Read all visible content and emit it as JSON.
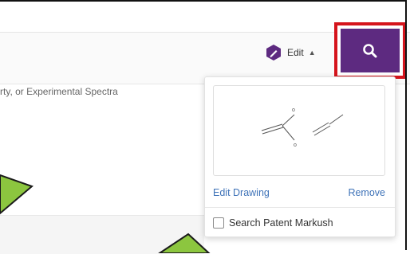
{
  "toolbar": {
    "edit_label": "Edit",
    "caret": "▲"
  },
  "search": {
    "hint_text": "rty, or Experimental Spectra"
  },
  "structure_popover": {
    "edit_drawing_label": "Edit Drawing",
    "remove_label": "Remove",
    "markush_label": "Search Patent Markush",
    "molecule_labels": [
      "o",
      "o"
    ]
  },
  "colors": {
    "search_button": "#5d2a80",
    "highlight_outline": "#d5141c",
    "link": "#3f73b8",
    "arrow_fill": "#8cc63f"
  },
  "icons": {
    "edit": "pencil-hexagon-icon",
    "search": "search-icon"
  }
}
